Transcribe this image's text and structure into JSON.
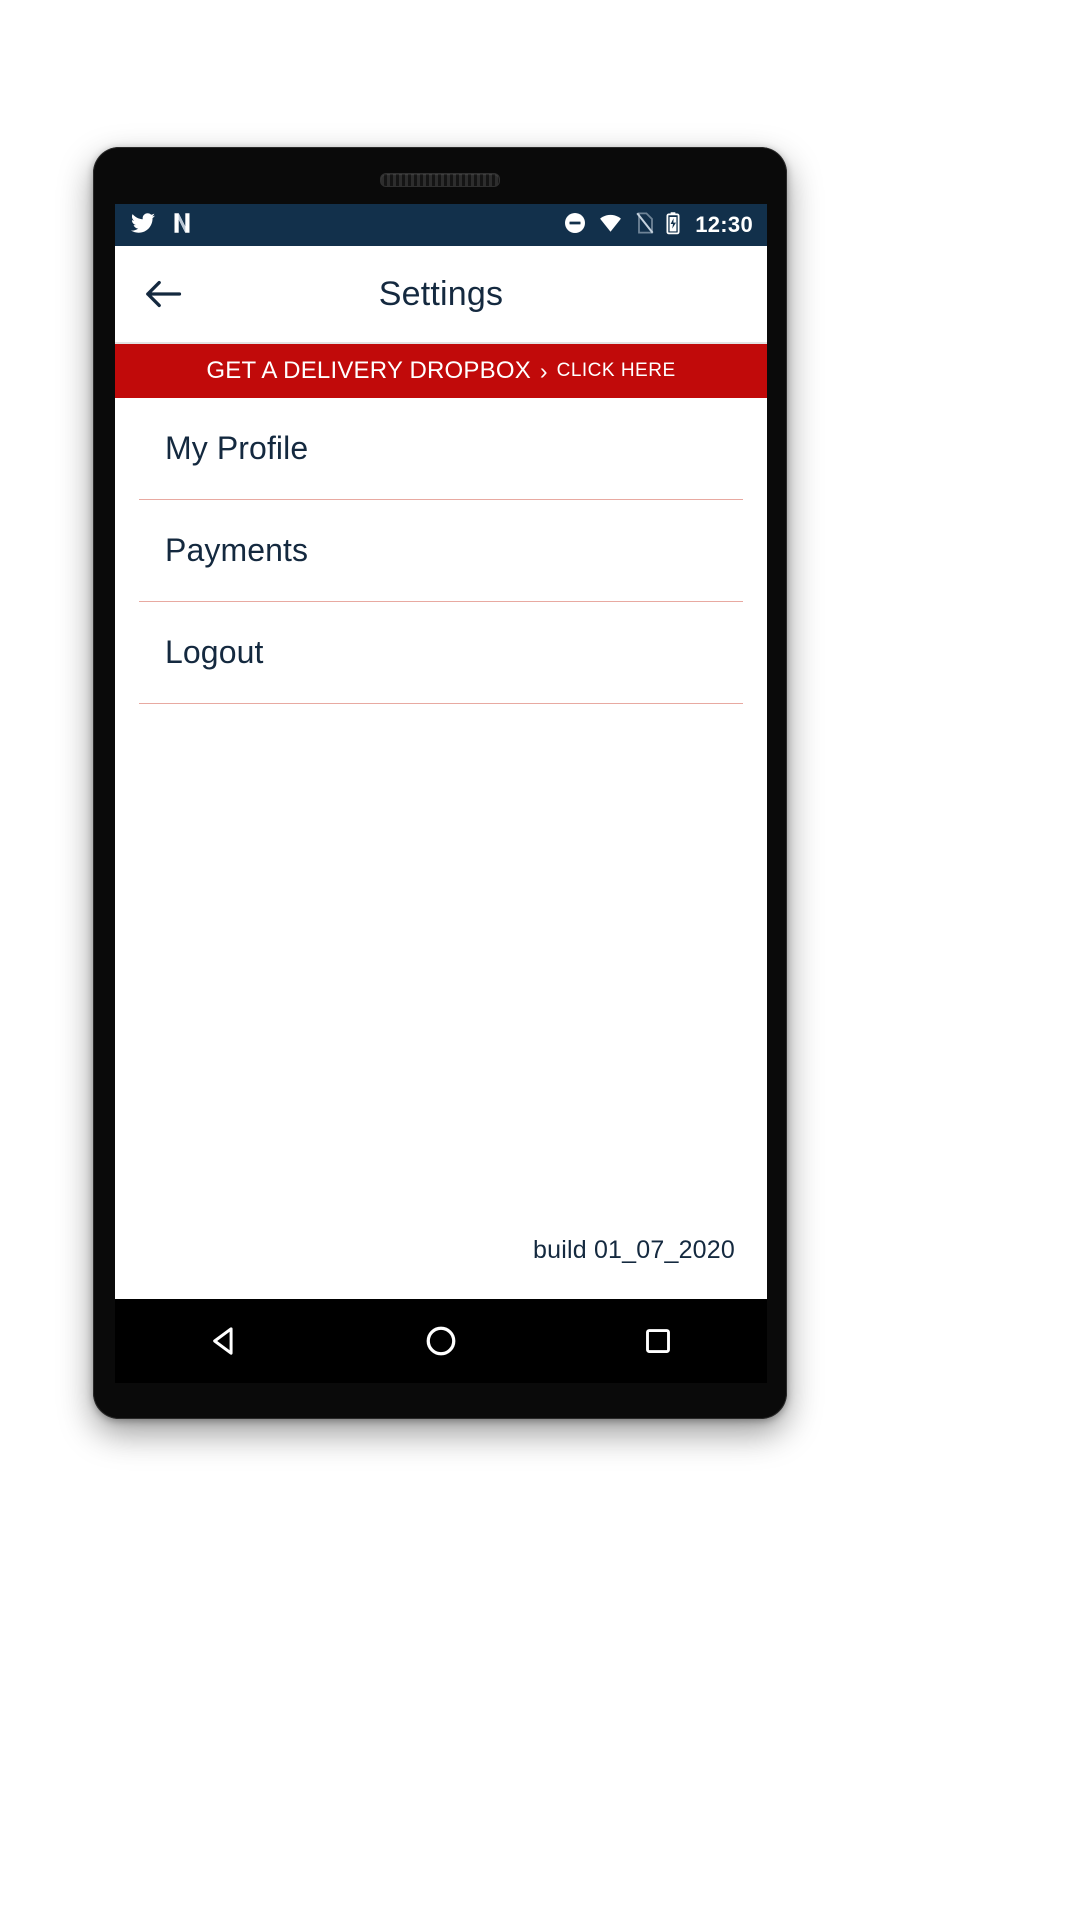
{
  "device": {
    "earpiece_icon": "speaker-grille"
  },
  "status_bar": {
    "background_color": "#12304b",
    "clock": "12:30",
    "left_icons": [
      {
        "name": "twitter-icon",
        "label": "Twitter notification"
      },
      {
        "name": "netflix-n-icon",
        "label": "N notification"
      }
    ],
    "right_icons": [
      {
        "name": "do-not-disturb-icon",
        "label": "Do Not Disturb"
      },
      {
        "name": "wifi-icon",
        "label": "Wi-Fi connected"
      },
      {
        "name": "no-sim-icon",
        "label": "No SIM card"
      },
      {
        "name": "battery-icon",
        "label": "Battery"
      }
    ]
  },
  "app_bar": {
    "back_icon": "back-arrow-icon",
    "title": "Settings",
    "title_color": "#14293f",
    "background_color": "#ffffff"
  },
  "promo_banner": {
    "background_color": "#c10a0a",
    "text_color": "#ffffff",
    "main_text": "GET A DELIVERY DROPBOX",
    "chevron": "›",
    "sub_text": "CLICK HERE"
  },
  "menu": {
    "divider_color": "#e8a9a1",
    "items": [
      {
        "label": "My Profile",
        "name": "my-profile"
      },
      {
        "label": "Payments",
        "name": "payments"
      },
      {
        "label": "Logout",
        "name": "logout"
      }
    ]
  },
  "footer": {
    "build_label": "build 01_07_2020"
  },
  "nav_bar": {
    "background_color": "#000000",
    "buttons": [
      {
        "name": "android-back-button",
        "icon": "triangle-left-icon"
      },
      {
        "name": "android-home-button",
        "icon": "circle-icon"
      },
      {
        "name": "android-recents-button",
        "icon": "square-icon"
      }
    ]
  }
}
